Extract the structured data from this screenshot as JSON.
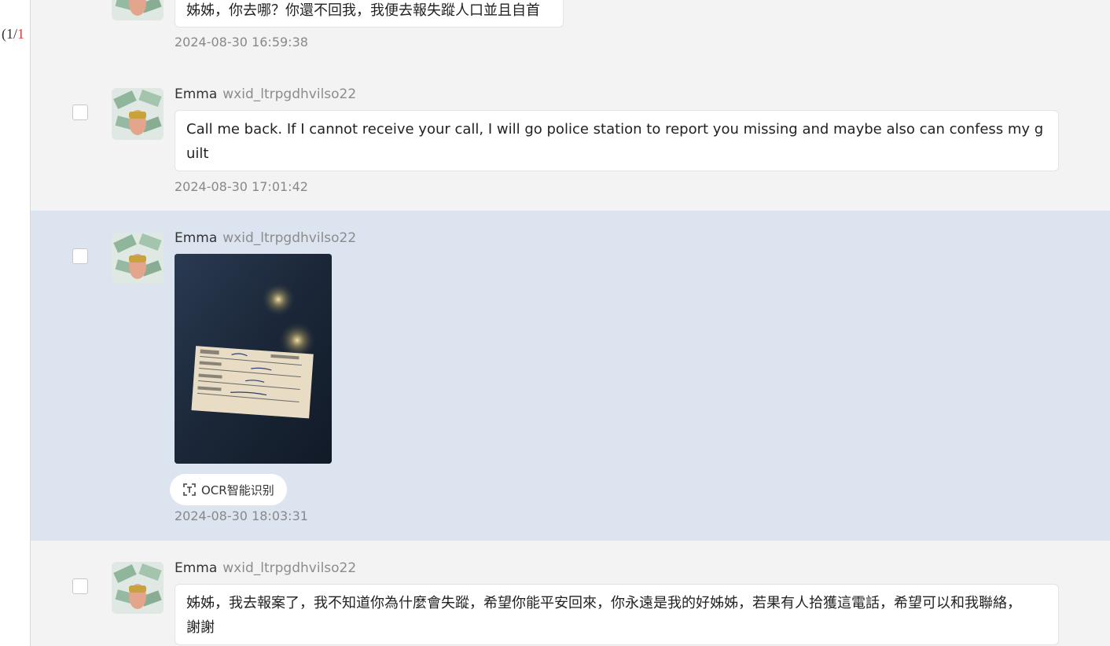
{
  "pager": {
    "prefix": "(1/",
    "current": "1"
  },
  "messages": [
    {
      "sender_name": "",
      "sender_id": "",
      "text": "姊姊，你去哪？你還不回我，我便去報失蹤人口並且自首",
      "time": "2024-08-30 16:59:38"
    },
    {
      "sender_name": "Emma",
      "sender_id": "wxid_ltrpgdhvilso22",
      "text": "Call me back. If I cannot receive your call, I will go police station to report you missing and maybe also can confess my guilt",
      "time": "2024-08-30 17:01:42"
    },
    {
      "sender_name": "Emma",
      "sender_id": "wxid_ltrpgdhvilso22",
      "image_alt": "police-report-card-photo",
      "ocr_label": "OCR智能识别",
      "time": "2024-08-30 18:03:31",
      "selected": true
    },
    {
      "sender_name": "Emma",
      "sender_id": "wxid_ltrpgdhvilso22",
      "text": "姊姊，我去報案了，我不知道你為什麼會失蹤，希望你能平安回來，你永遠是我的好姊姊，若果有人拾獲這電話，希望可以和我聯絡，謝謝",
      "time": ""
    }
  ],
  "colors": {
    "selected_row": "#dce4f0",
    "row_bg": "#f3f3f3",
    "pager_current": "#e03a3a"
  },
  "icons": {
    "avatar": "avatar-image",
    "ocr": "ocr-scan-icon"
  }
}
